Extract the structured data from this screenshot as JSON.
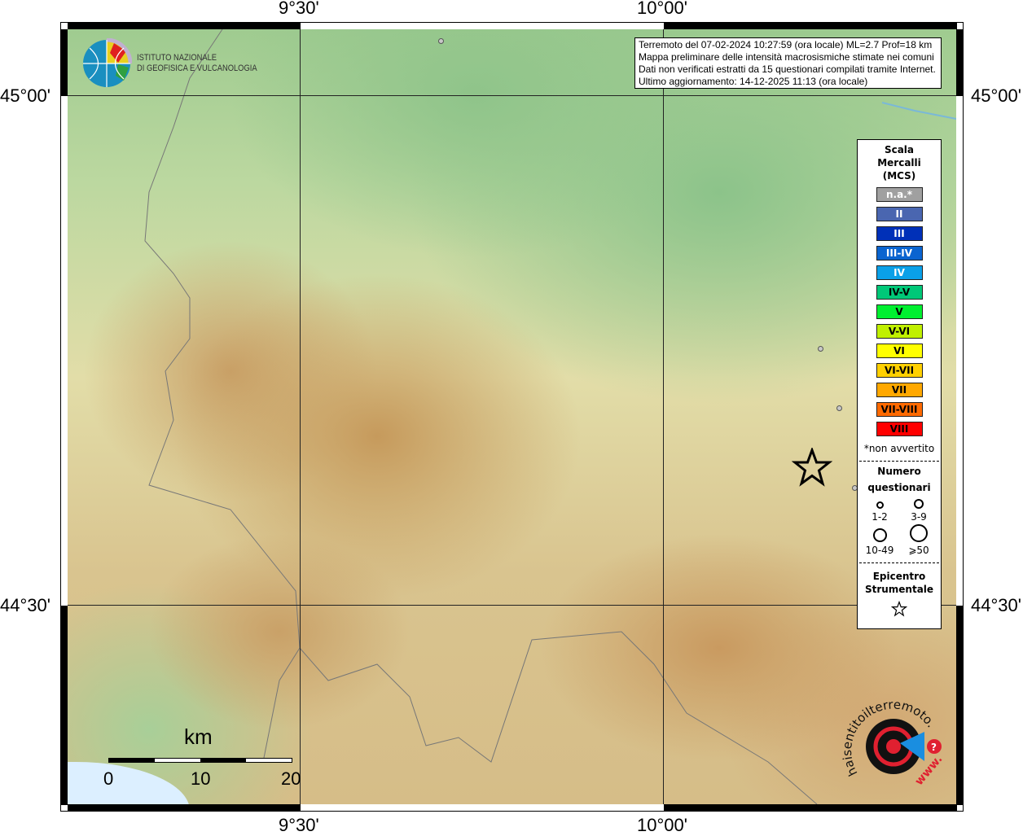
{
  "coords": {
    "lon_top": [
      "9°30'",
      "10°00'"
    ],
    "lon_bottom": [
      "9°30'",
      "10°00'"
    ],
    "lat_left": [
      "45°00'",
      "44°30'"
    ],
    "lat_right": [
      "45°00'",
      "44°30'"
    ]
  },
  "logo": {
    "line1": "ISTITUTO NAZIONALE",
    "line2": "DI GEOFISICA E VULCANOLOGIA"
  },
  "info": [
    "Terremoto del 07-02-2024 10:27:59 (ora locale) ML=2.7 Prof=18 km",
    "Mappa preliminare delle intensità macrosismiche stimate nei comuni",
    "Dati non verificati estratti da 15 questionari compilati tramite Internet.",
    "Ultimo aggiornamento: 14-12-2025 11:13 (ora locale)"
  ],
  "legend": {
    "title": [
      "Scala",
      "Mercalli",
      "(MCS)"
    ],
    "classes": [
      {
        "label": "n.a.*",
        "color": "#a0a0a0",
        "text": "#fff"
      },
      {
        "label": "II",
        "color": "#4a66b0",
        "text": "#fff"
      },
      {
        "label": "III",
        "color": "#0030b8",
        "text": "#fff"
      },
      {
        "label": "III-IV",
        "color": "#0a64d0",
        "text": "#fff"
      },
      {
        "label": "IV",
        "color": "#0aa0e8",
        "text": "#fff"
      },
      {
        "label": "IV-V",
        "color": "#00c878",
        "text": "#000"
      },
      {
        "label": "V",
        "color": "#00f030",
        "text": "#000"
      },
      {
        "label": "V-VI",
        "color": "#c0f000",
        "text": "#000"
      },
      {
        "label": "VI",
        "color": "#ffff00",
        "text": "#000"
      },
      {
        "label": "VI-VII",
        "color": "#ffd000",
        "text": "#000"
      },
      {
        "label": "VII",
        "color": "#ffa800",
        "text": "#000"
      },
      {
        "label": "VII-VIII",
        "color": "#ff6a00",
        "text": "#000"
      },
      {
        "label": "VIII",
        "color": "#ff0000",
        "text": "#000"
      }
    ],
    "note": "*non avvertito",
    "count_title": [
      "Numero",
      "questionari"
    ],
    "counts": [
      "1-2",
      "3-9",
      "10-49",
      "⩾50"
    ],
    "epi_title": [
      "Epicentro",
      "Strumentale"
    ]
  },
  "scalebar": {
    "unit": "km",
    "ticks": [
      "0",
      "10",
      "20"
    ]
  },
  "haisentito": {
    "text": "haisentitoilterremoto.it",
    "www": "www."
  }
}
